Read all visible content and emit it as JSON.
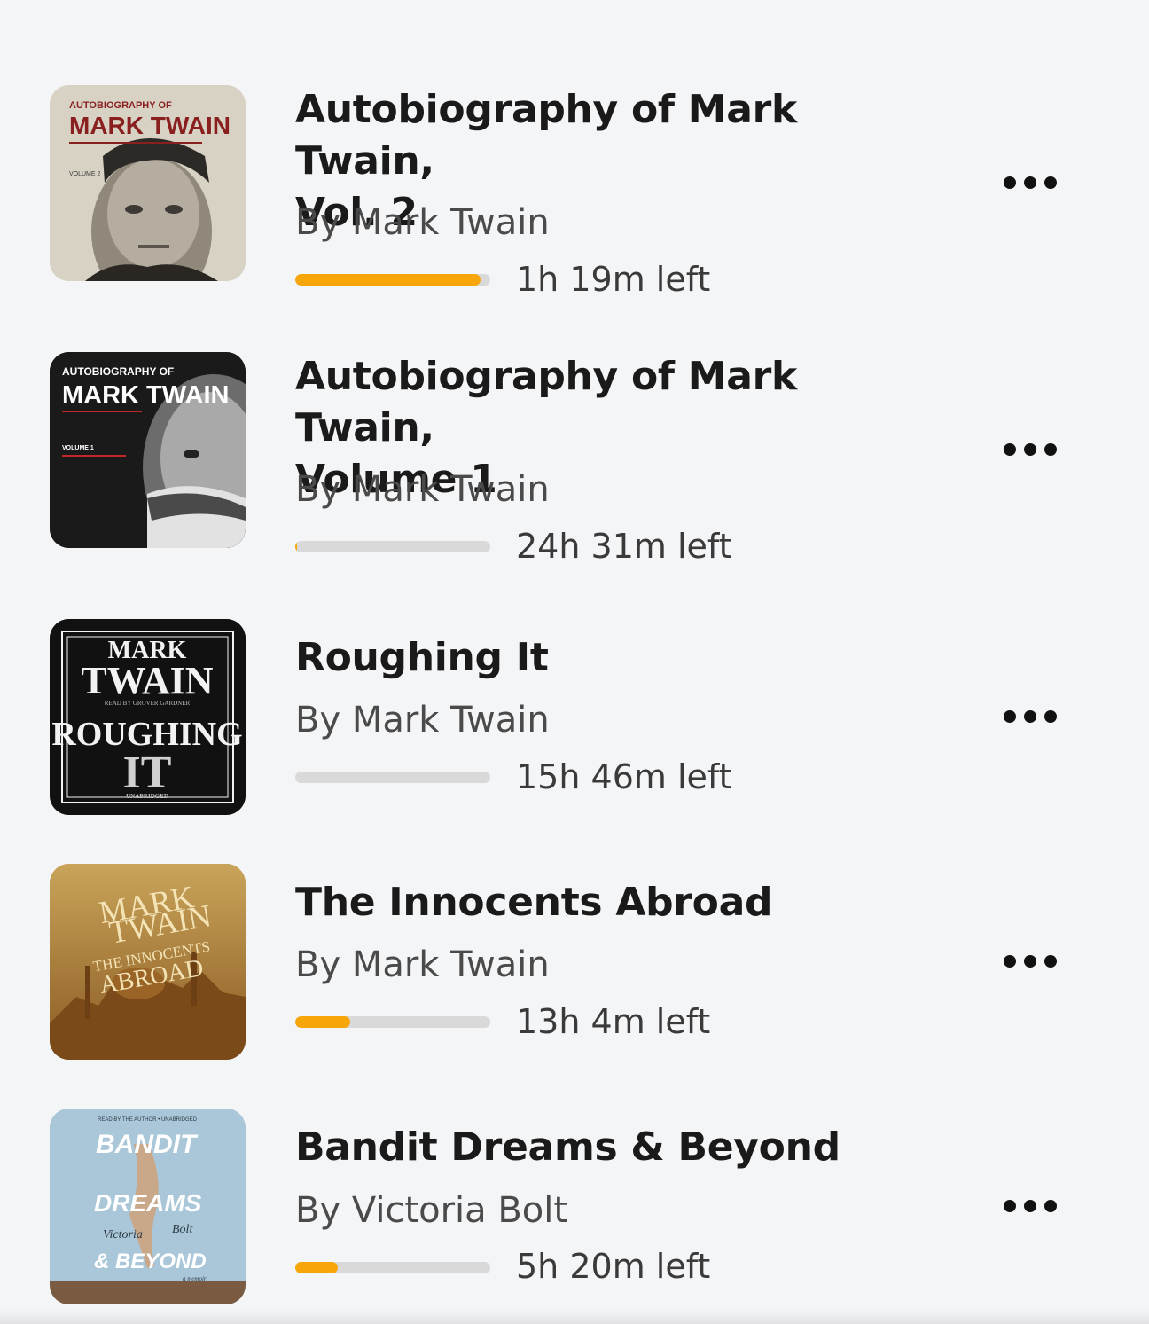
{
  "books": [
    {
      "title_line1": "Autobiography of Mark Twain,",
      "title_line2": "Vol. 2",
      "author": "By Mark Twain",
      "time_left": "1h 19m left",
      "progress_fraction": 0.95,
      "cover": {
        "top_text": "AUTOBIOGRAPHY OF",
        "main_text": "MARK TWAIN",
        "sub_text": "VOLUME 2",
        "background": "#d9d4c8",
        "text_color": "#8a1f1f"
      },
      "menu_icon": "more-horizontal-icon"
    },
    {
      "title_line1": "Autobiography of Mark Twain,",
      "title_line2": "Volume 1",
      "author": "By Mark Twain",
      "time_left": "24h 31m left",
      "progress_fraction": 0.01,
      "cover": {
        "top_text": "AUTOBIOGRAPHY OF",
        "main_text": "MARK TWAIN",
        "sub_text": "VOLUME 1",
        "background": "#1c1c1c",
        "text_color": "#ffffff"
      },
      "menu_icon": "more-horizontal-icon"
    },
    {
      "title_line1": "Roughing It",
      "title_line2": "",
      "author": "By Mark Twain",
      "time_left": "15h 46m left",
      "progress_fraction": 0.0,
      "cover": {
        "top_text": "MARK",
        "main_text": "TWAIN",
        "sub_text": "ROUGHING",
        "bottom_text": "IT",
        "read_by": "READ BY GROVER GARDNER",
        "edition": "UNABRIDGED",
        "background": "#111111",
        "text_color": "#f2f2f2"
      },
      "menu_icon": "more-horizontal-icon"
    },
    {
      "title_line1": "The Innocents Abroad",
      "title_line2": "",
      "author": "By Mark Twain",
      "time_left": "13h 4m left",
      "progress_fraction": 0.28,
      "cover": {
        "top_text": "MARK",
        "main_text": "TWAIN",
        "sub_text": "THE INNOCENTS",
        "bottom_text": "ABROAD",
        "background": "#b98a3c",
        "text_color": "#f3e3b5"
      },
      "menu_icon": "more-horizontal-icon"
    },
    {
      "title_line1": "Bandit Dreams & Beyond",
      "title_line2": "",
      "author": "By Victoria Bolt",
      "time_left": "5h 20m left",
      "progress_fraction": 0.22,
      "cover": {
        "top_text": "READ BY THE AUTHOR • UNABRIDGED",
        "main_text": "BANDIT",
        "sub_text": "DREAMS",
        "bottom_text": "& BEYOND",
        "author_first": "Victoria",
        "author_last": "Bolt",
        "tag": "a memoir",
        "background": "#a8c6d8",
        "text_color": "#ffffff"
      },
      "menu_icon": "more-horizontal-icon"
    }
  ],
  "colors": {
    "background": "#f4f5f7",
    "progress_fill": "#f6a609",
    "progress_track": "#d9d9d9",
    "title": "#1a1a1a",
    "author": "#4a4a4a"
  }
}
